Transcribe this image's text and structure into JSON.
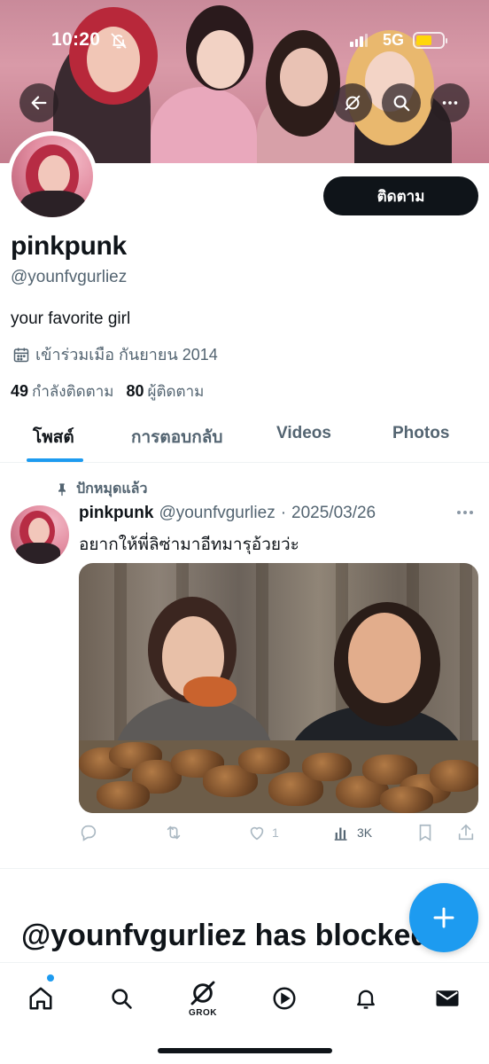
{
  "status_bar": {
    "time": "10:20",
    "network": "5G"
  },
  "colors": {
    "accent": "#1d9bf0",
    "text_primary": "#0f1419",
    "text_secondary": "#536471",
    "battery": "#ffd60a"
  },
  "header": {
    "back_icon": "arrow-left-icon",
    "grok_icon": "grok-icon",
    "search_icon": "search-icon",
    "more_icon": "more-horizontal-icon"
  },
  "profile": {
    "display_name": "pinkpunk",
    "handle": "@younfvgurliez",
    "bio": "your favorite girl",
    "joined": "เข้าร่วมเมือ กันยายน 2014",
    "follow_label": "ติดตาม",
    "following_count": "49",
    "following_label": "กำลังติดตาม",
    "followers_count": "80",
    "followers_label": "ผู้ติดตาม"
  },
  "tabs": [
    {
      "label": "โพสต์",
      "active": true
    },
    {
      "label": "การตอบกลับ",
      "active": false
    },
    {
      "label": "Videos",
      "active": false
    },
    {
      "label": "Photos",
      "active": false
    }
  ],
  "tweet": {
    "pinned_label": "ปักหมุดแล้ว",
    "name": "pinkpunk",
    "handle": "@younfvgurliez",
    "separator": "·",
    "date": "2025/03/26",
    "text": "อยากให้พี่ลิซ่ามาอีทมารุอ้วยว่ะ",
    "likes": "1",
    "views": "3K"
  },
  "blocked_text": "@younfvgurliez has blocked",
  "bottom_nav": {
    "grok_label": "GROK",
    "items": [
      "home-icon",
      "search-icon",
      "grok-icon",
      "play-icon",
      "bell-icon",
      "mail-icon"
    ]
  }
}
